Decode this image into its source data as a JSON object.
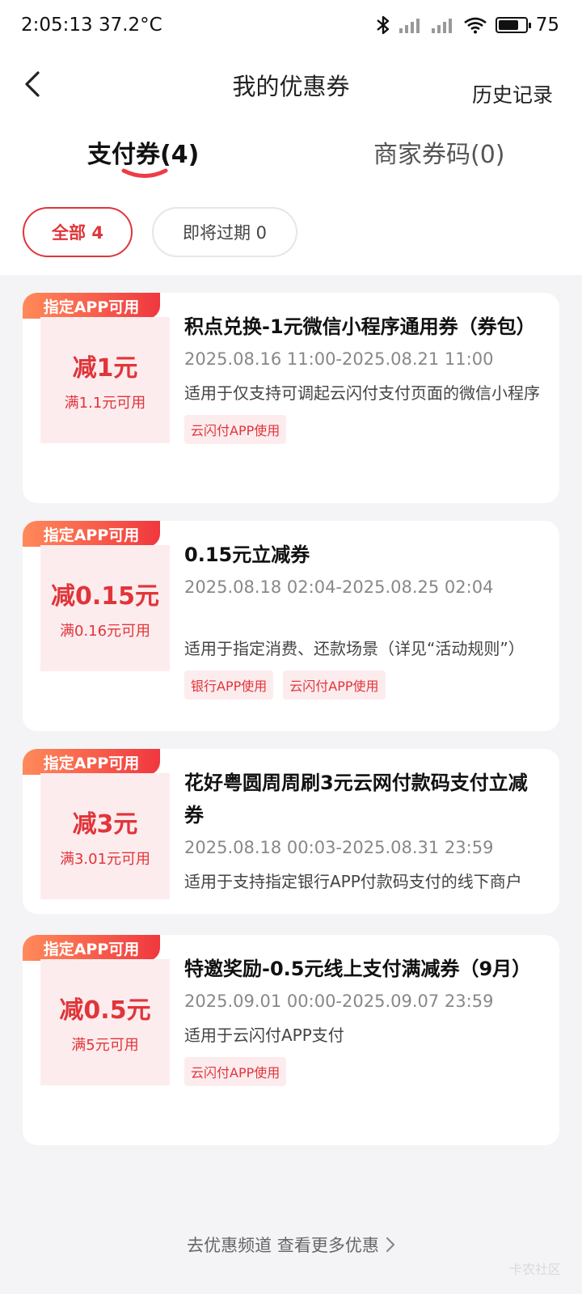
{
  "status_bar": {
    "time_temp": "2:05:13 37.2°C",
    "battery": "75",
    "battery_level": 0.75,
    "icons": [
      "bluetooth-icon",
      "signal-icon",
      "signal-icon",
      "wifi-icon",
      "battery-icon"
    ]
  },
  "header": {
    "title": "我的优惠券",
    "history": "历史记录"
  },
  "tabs": [
    {
      "label": "支付券(4)",
      "active": true
    },
    {
      "label": "商家券码(0)",
      "active": false
    }
  ],
  "filters": [
    {
      "label": "全部 4",
      "active": true
    },
    {
      "label": "即将过期 0",
      "active": false
    }
  ],
  "coupons": [
    {
      "badge": "指定APP可用",
      "amount": "减1元",
      "condition": "满1.1元可用",
      "name": "积点兑换-1元微信小程序通用券（券包）",
      "date": "2025.08.16 11:00-2025.08.21 11:00",
      "desc": "适用于仅支持可调起云闪付支付页面的微信小程序",
      "tags": [
        "云闪付APP使用"
      ]
    },
    {
      "badge": "指定APP可用",
      "amount": "减0.15元",
      "condition": "满0.16元可用",
      "name": "0.15元立减券",
      "date": "2025.08.18 02:04-2025.08.25 02:04",
      "desc": "适用于指定消费、还款场景（详见“活动规则”）",
      "tags": [
        "银行APP使用",
        "云闪付APP使用"
      ]
    },
    {
      "badge": "指定APP可用",
      "amount": "减3元",
      "condition": "满3.01元可用",
      "name": "花好粤圆周周刷3元云网付款码支付立减券",
      "date": "2025.08.18 00:03-2025.08.31 23:59",
      "desc": "适用于支持指定银行APP付款码支付的线下商户",
      "tags": []
    },
    {
      "badge": "指定APP可用",
      "amount": "减0.5元",
      "condition": "满5元可用",
      "name": "特邀奖励-0.5元线上支付满减券（9月）",
      "date": "2025.09.01 00:00-2025.09.07 23:59",
      "desc": "适用于云闪付APP支付",
      "tags": [
        "云闪付APP使用"
      ]
    }
  ],
  "footer": {
    "text": "去优惠频道 查看更多优惠"
  },
  "watermark": "卡农社区"
}
